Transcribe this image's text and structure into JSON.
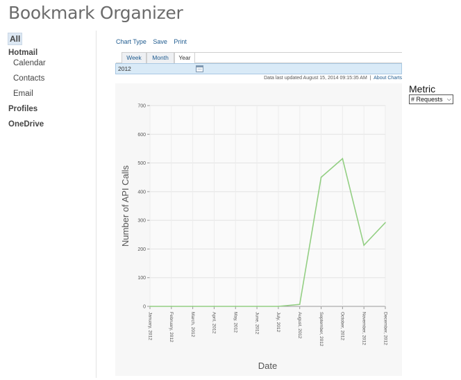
{
  "app": {
    "title": "Bookmark Organizer"
  },
  "sidebar": {
    "all_label": "All",
    "items": [
      {
        "label": "Hotmail",
        "group": true
      },
      {
        "label": "Calendar",
        "group": false
      },
      {
        "label": "Contacts",
        "group": false
      },
      {
        "label": "Email",
        "group": false
      },
      {
        "label": "Profiles",
        "group": true
      },
      {
        "label": "OneDrive",
        "group": true
      }
    ]
  },
  "toolbar": {
    "chart_type": "Chart Type",
    "save": "Save",
    "print": "Print"
  },
  "tabs": {
    "week": "Week",
    "month": "Month",
    "year": "Year",
    "active": "Year"
  },
  "date_picker": {
    "value": "2012",
    "icon": "calendar-icon"
  },
  "status": {
    "updated": "Data last updated August 15, 2014 09:15:35 AM",
    "separator": "|",
    "about_link": "About Charts"
  },
  "metric": {
    "label": "Metric",
    "selected": "# Requests"
  },
  "chart_data": {
    "type": "line",
    "xlabel": "Date",
    "ylabel": "Number of API Calls",
    "ylim": [
      0,
      700
    ],
    "yticks": [
      0,
      100,
      200,
      300,
      400,
      500,
      600,
      700
    ],
    "categories": [
      "January, 2012",
      "February, 2012",
      "March, 2012",
      "April, 2012",
      "May, 2012",
      "June, 2012",
      "July, 2012",
      "August, 2012",
      "September, 2012",
      "October, 2012",
      "November, 2012",
      "December, 2012"
    ],
    "series": [
      {
        "values": [
          0,
          0,
          0,
          0,
          0,
          0,
          0,
          7,
          450,
          515,
          213,
          292
        ],
        "color": "#93cf83"
      }
    ],
    "grid": true
  }
}
